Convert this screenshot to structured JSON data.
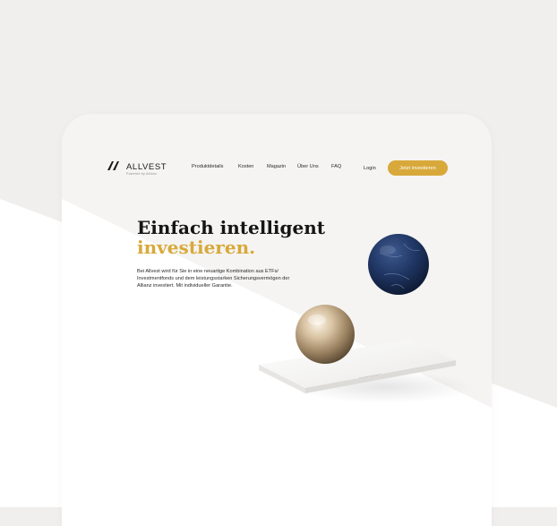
{
  "colors": {
    "accent": "#d8a93a",
    "page_bg": "#f1efed",
    "text": "#151515"
  },
  "brand": {
    "name": "ALLVEST",
    "tagline": "Powered by Allianz"
  },
  "nav": {
    "items": [
      {
        "label": "Produktdetails"
      },
      {
        "label": "Kosten"
      },
      {
        "label": "Magazin"
      },
      {
        "label": "Über Uns"
      },
      {
        "label": "FAQ"
      }
    ],
    "login_label": "Login",
    "cta_label": "Jetzt investieren"
  },
  "hero": {
    "title_line1": "Einfach intelligent",
    "title_line2": "investieren.",
    "copy": "Bei Allvest wird für Sie in eine neuartige Kombination aus ETFs/ Investmentfonds und dem leistungsstarken Sicherungsvermögen der Allianz investiert. Mit individueller Garantie."
  },
  "illustration": {
    "subject": "seesaw with gold sphere and blue marble sphere"
  }
}
